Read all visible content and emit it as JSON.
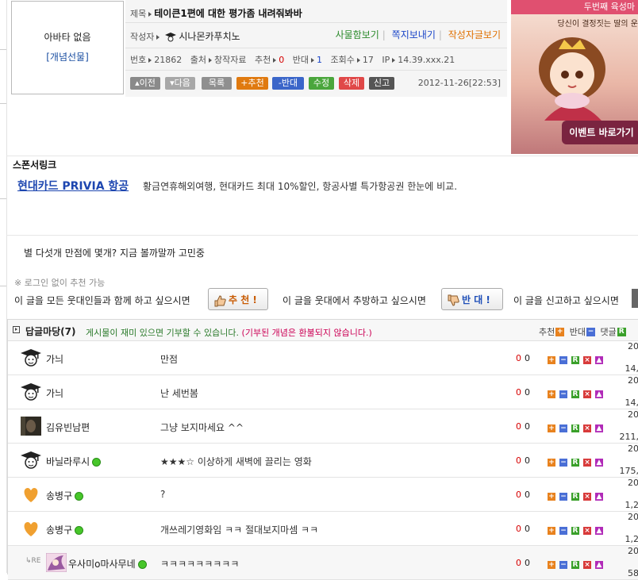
{
  "author": {
    "avatar_text": "아바타 없음",
    "gift_link": "[개념선물]"
  },
  "post": {
    "title_label": "제목",
    "title": "테이큰1편에 대한 평가좀 내려줘봐바",
    "author_label": "작성자",
    "author_name": "시나몬카푸치노",
    "links": [
      "사물함보기",
      "쪽지보내기",
      "작성자글보기"
    ],
    "no_label": "번호",
    "no": "21862",
    "source_label": "출처",
    "source": "창작자료",
    "up_label": "추천",
    "up": "0",
    "down_label": "반대",
    "down": "1",
    "views_label": "조회수",
    "views": "17",
    "ip_label": "IP",
    "ip": "14.39.xxx.21",
    "buttons": {
      "prev": "▴이전",
      "next": "▾다음",
      "list": "목록",
      "recommend": "+추천",
      "oppose": "-반대",
      "edit": "수정",
      "delete": "삭제",
      "report": "신고"
    },
    "date": "2012-11-26[22:53]",
    "body": "별 다섯개 만점에 몇개? 지금 볼까말까 고민중"
  },
  "banner": {
    "caption": "두번째 육성마",
    "subtitle": "당신이 결정짓는 딸의 운",
    "event_button": "이벤트 바로가기"
  },
  "sponsor": {
    "title": "스폰서링크",
    "link": "현대카드 PRIVIA 항공",
    "desc": "황금연휴해외여행, 현대카드 최대 10%할인, 항공사별 특가항공권 한눈에 비교."
  },
  "vote": {
    "note": "※ 로그인 없이 추천 가능",
    "recommend_text": "이 글을 모든 웃대인들과 함께 하고 싶으시면",
    "recommend_btn": "추 천 !",
    "oppose_text": "이 글을 웃대에서 추방하고 싶으시면",
    "oppose_btn": "반 대 !",
    "report_text": "이 글을 신고하고 싶으시면"
  },
  "comments": {
    "title": "답글마당(7)",
    "subtitle": "게시물이 재미 있으면 기부할 수 있습니다.",
    "subtitle_red": "(기부된 개념은 환불되지 않습니다.)",
    "sort": {
      "up": "추천",
      "down": "반대",
      "reply": "댓글"
    },
    "colors": {
      "up": "#e8821e",
      "down": "#4a6fd6",
      "reply": "#3aa02a",
      "cancel": "#d83a3a",
      "report": "#b12bb8"
    },
    "items": [
      {
        "nick": "가늬",
        "text": "만점",
        "up": "0",
        "down": "0",
        "time1": "20",
        "time2": "14,",
        "avatar": "graduate-icon",
        "online": false,
        "reply": false
      },
      {
        "nick": "가늬",
        "text": "난 세번봄",
        "up": "0",
        "down": "0",
        "time1": "20",
        "time2": "14,",
        "avatar": "graduate-icon",
        "online": false,
        "reply": false
      },
      {
        "nick": "김유빈남편",
        "text": "그냥 보지마세요 ^^",
        "up": "0",
        "down": "0",
        "time1": "20",
        "time2": "211,",
        "avatar": "photo-avatar",
        "online": false,
        "reply": false
      },
      {
        "nick": "바닐라루시",
        "text": "★★★☆ 이상하게 새벽에 끌리는 영화",
        "up": "0",
        "down": "0",
        "time1": "20",
        "time2": "175,",
        "avatar": "graduate-icon",
        "online": true,
        "reply": false
      },
      {
        "nick": "송병구",
        "text": "?",
        "up": "0",
        "down": "0",
        "time1": "20",
        "time2": "1,2",
        "avatar": "heart-icon",
        "online": true,
        "reply": false
      },
      {
        "nick": "송병구",
        "text": "개쓰레기영화임 ㅋㅋ 절대보지마셈 ㅋㅋ",
        "up": "0",
        "down": "0",
        "time1": "20",
        "time2": "1,2",
        "avatar": "heart-icon",
        "online": true,
        "reply": false
      },
      {
        "nick": "우사미o마사무네",
        "text": "ㅋㅋㅋㅋㅋㅋㅋㅋㅋ",
        "up": "0",
        "down": "0",
        "time1": "20",
        "time2": "58",
        "avatar": "anime-avatar",
        "online": true,
        "reply": true
      }
    ]
  }
}
